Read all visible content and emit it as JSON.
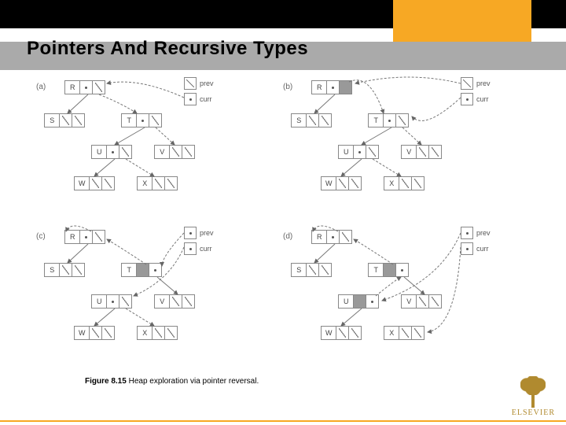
{
  "header": {
    "title": "Pointers And Recursive Types",
    "slide_number": ""
  },
  "figure": {
    "panel_labels": {
      "a": "(a)",
      "b": "(b)",
      "c": "(c)",
      "d": "(d)"
    },
    "nodes": [
      "R",
      "S",
      "T",
      "U",
      "V",
      "W",
      "X"
    ],
    "pointer_labels": {
      "prev": "prev",
      "curr": "curr"
    }
  },
  "caption": {
    "figure_label": "Figure 8.15",
    "figure_text": "Heap exploration via pointer reversal."
  },
  "branding": {
    "name": "ELSEVIER"
  }
}
